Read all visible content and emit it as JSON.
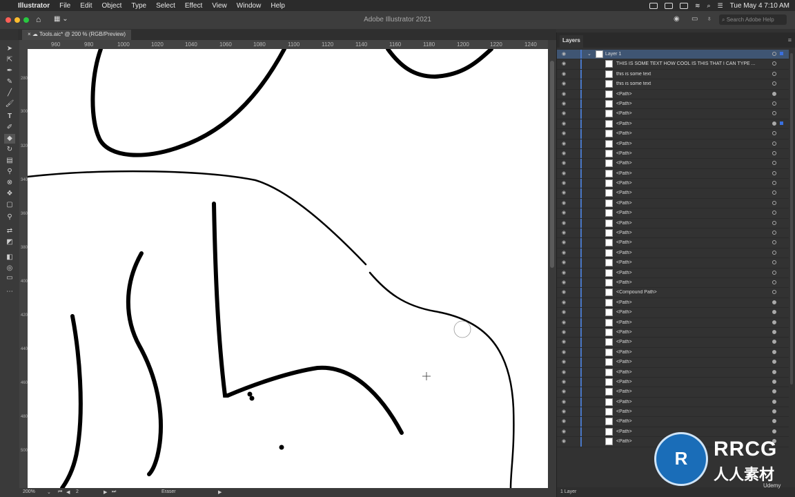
{
  "menubar": {
    "app": "Illustrator",
    "items": [
      "File",
      "Edit",
      "Object",
      "Type",
      "Select",
      "Effect",
      "View",
      "Window",
      "Help"
    ],
    "datetime": "Tue May 4  7:10 AM"
  },
  "appbar": {
    "title": "Adobe Illustrator 2021",
    "search_placeholder": "Search Adobe Help"
  },
  "document": {
    "tab_label": "Tools.aic* @ 200 % (RGB/Preview)"
  },
  "ruler": {
    "h_ticks": [
      "960",
      "980",
      "1000",
      "1020",
      "1040",
      "1060",
      "1080",
      "1100",
      "1120",
      "1140",
      "1160",
      "1180",
      "1200",
      "1220",
      "1240"
    ],
    "v_ticks": [
      "280",
      "300",
      "320",
      "340",
      "360",
      "380",
      "400",
      "420",
      "440",
      "460",
      "480",
      "500"
    ]
  },
  "status": {
    "zoom": "200%",
    "artboard": "2",
    "tool": "Eraser"
  },
  "layers": {
    "panel_title": "Layers",
    "layer_name": "Layer 1",
    "items": [
      "THIS IS SOME TEXT HOW COOL IS THIS THAT I CAN TYPE ...",
      "this is some text",
      "this is some text",
      "<Path>",
      "<Path>",
      "<Path>",
      "<Path>",
      "<Path>",
      "<Path>",
      "<Path>",
      "<Path>",
      "<Path>",
      "<Path>",
      "<Path>",
      "<Path>",
      "<Path>",
      "<Path>",
      "<Path>",
      "<Path>",
      "<Path>",
      "<Path>",
      "<Path>",
      "<Path>",
      "<Compound Path>",
      "<Path>",
      "<Path>",
      "<Path>",
      "<Path>",
      "<Path>",
      "<Path>",
      "<Path>",
      "<Path>",
      "<Path>",
      "<Path>",
      "<Path>",
      "<Path>",
      "<Path>",
      "<Path>",
      "<Path>"
    ],
    "footer": "1 Layer"
  },
  "watermark": {
    "brand": "RRCG",
    "sub": "人人素材",
    "udemy": "Udemy"
  },
  "colors": {
    "accent": "#4a78c8",
    "selection": "#3a70e0"
  }
}
